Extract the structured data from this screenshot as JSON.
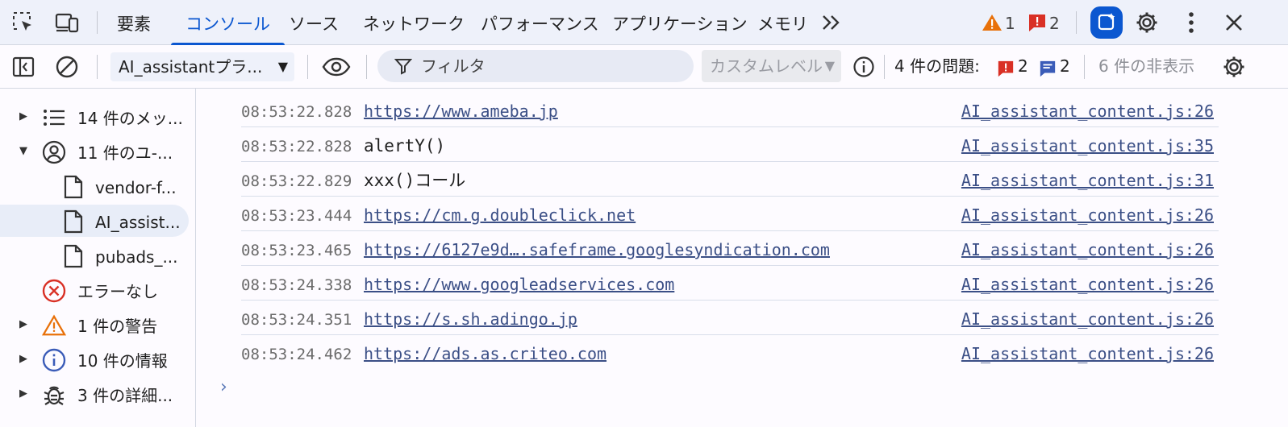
{
  "tabs": [
    {
      "label": "要素",
      "active": false
    },
    {
      "label": "コンソール",
      "active": true
    },
    {
      "label": "ソース",
      "active": false
    },
    {
      "label": "ネットワーク",
      "active": false
    },
    {
      "label": "パフォーマンス",
      "active": false
    },
    {
      "label": "アプリケーション",
      "active": false
    },
    {
      "label": "メモリ",
      "active": false
    }
  ],
  "header": {
    "warning_count": "1",
    "error_count": "2"
  },
  "toolbar": {
    "context": "AI_assistantプラ...",
    "filter_placeholder": "フィルタ",
    "level": "カスタムレベル",
    "issues_label": "4 件の問題:",
    "issues_errors": "2",
    "issues_info": "2",
    "hidden": "6 件の非表示"
  },
  "sidebar": {
    "items": [
      {
        "label": "14 件のメッ..."
      },
      {
        "label": "11 件のユ-..."
      },
      {
        "label": "vendor-f..."
      },
      {
        "label": "AI_assist..."
      },
      {
        "label": "pubads_..."
      },
      {
        "label": "エラーなし"
      },
      {
        "label": "1 件の警告"
      },
      {
        "label": "10 件の情報"
      },
      {
        "label": "3 件の詳細..."
      }
    ]
  },
  "console": {
    "rows": [
      {
        "time": "08:53:22.828",
        "message": "https://www.ameba.jp",
        "link": true,
        "source": "AI_assistant_content.js:26"
      },
      {
        "time": "08:53:22.828",
        "message": "alertY()",
        "link": false,
        "source": "AI_assistant_content.js:35"
      },
      {
        "time": "08:53:22.829",
        "message": "xxx()コール",
        "link": false,
        "source": "AI_assistant_content.js:31"
      },
      {
        "time": "08:53:23.444",
        "message": "https://cm.g.doubleclick.net",
        "link": true,
        "source": "AI_assistant_content.js:26"
      },
      {
        "time": "08:53:23.465",
        "message": "https://6127e9d….safeframe.googlesyndication.com",
        "link": true,
        "source": "AI_assistant_content.js:26"
      },
      {
        "time": "08:53:24.338",
        "message": "https://www.googleadservices.com",
        "link": true,
        "source": "AI_assistant_content.js:26"
      },
      {
        "time": "08:53:24.351",
        "message": "https://s.sh.adingo.jp",
        "link": true,
        "source": "AI_assistant_content.js:26"
      },
      {
        "time": "08:53:24.462",
        "message": "https://ads.as.criteo.com",
        "link": true,
        "source": "AI_assistant_content.js:26"
      }
    ],
    "prompt": "›"
  },
  "colors": {
    "accent": "#0b57d0",
    "warning": "#e8710a",
    "error": "#d93025",
    "link": "#3b4f86"
  },
  "icons": [
    "inspect-icon",
    "device-icon",
    "more-tabs-icon",
    "warning-icon",
    "error-icon",
    "ai-assistant-icon",
    "gear-icon",
    "kebab-menu-icon",
    "close-icon",
    "sidebar-toggle-icon",
    "clear-icon",
    "eye-icon",
    "filter-icon",
    "info-icon",
    "message-icon",
    "list-icon",
    "user-icon",
    "file-icon",
    "error-circle-icon",
    "bug-icon"
  ]
}
